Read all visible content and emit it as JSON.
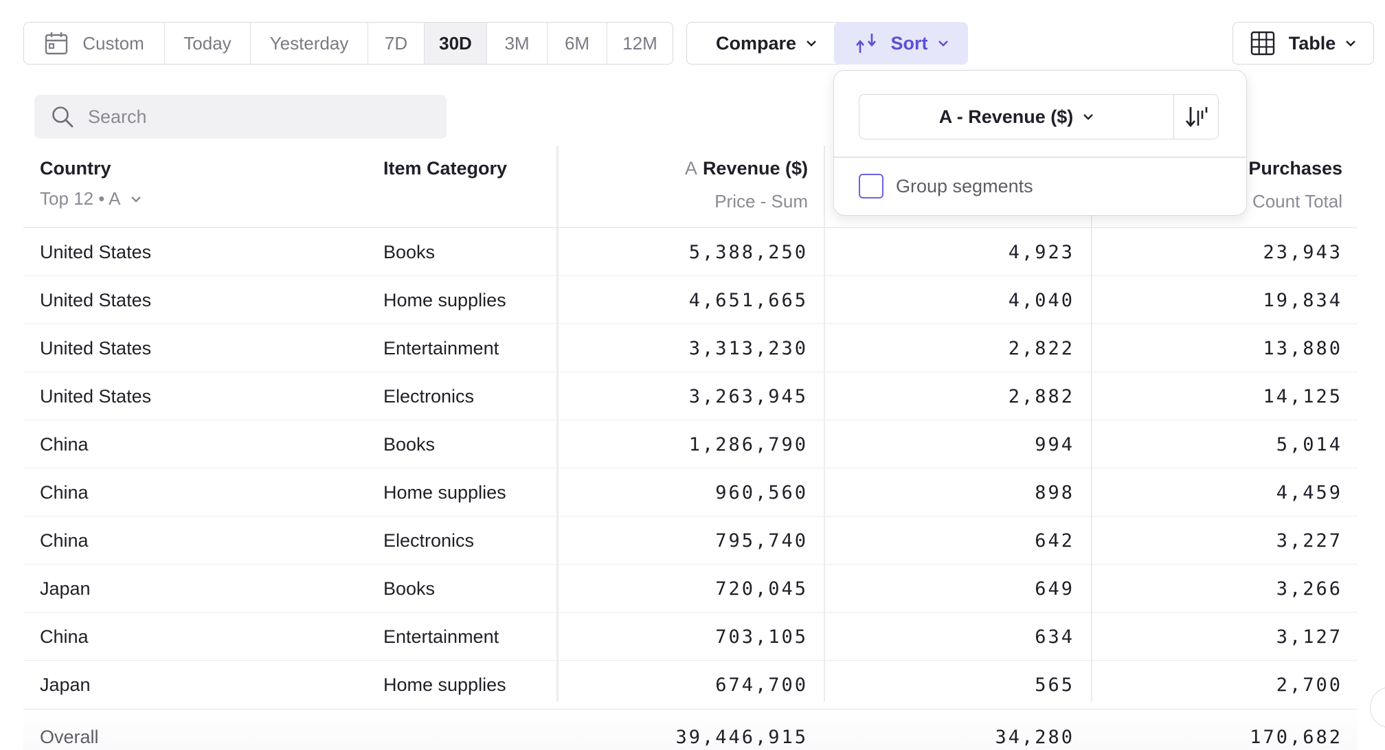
{
  "toolbar": {
    "date_ranges": [
      {
        "label": "Custom",
        "icon": "calendar-icon",
        "active": false
      },
      {
        "label": "Today",
        "active": false
      },
      {
        "label": "Yesterday",
        "active": false
      },
      {
        "label": "7D",
        "active": false
      },
      {
        "label": "30D",
        "active": true
      },
      {
        "label": "3M",
        "active": false
      },
      {
        "label": "6M",
        "active": false
      },
      {
        "label": "12M",
        "active": false
      }
    ],
    "compare_label": "Compare",
    "sort_label": "Sort",
    "view_label": "Table",
    "accent_color": "#5b4fd6"
  },
  "search": {
    "placeholder": "Search"
  },
  "table": {
    "headers": {
      "country": "Country",
      "country_sub": "Top 12 • A",
      "category": "Item Category",
      "a_prefix": "A",
      "a_title": "Revenue ($)",
      "a_sub": "Price - Sum",
      "c_title": "# Purchases",
      "c_sub": "Count Total"
    },
    "rows": [
      {
        "country": "United States",
        "category": "Books",
        "a": "5,388,250",
        "b": "4,923",
        "c": "23,943"
      },
      {
        "country": "United States",
        "category": "Home supplies",
        "a": "4,651,665",
        "b": "4,040",
        "c": "19,834"
      },
      {
        "country": "United States",
        "category": "Entertainment",
        "a": "3,313,230",
        "b": "2,822",
        "c": "13,880"
      },
      {
        "country": "United States",
        "category": "Electronics",
        "a": "3,263,945",
        "b": "2,882",
        "c": "14,125"
      },
      {
        "country": "China",
        "category": "Books",
        "a": "1,286,790",
        "b": "994",
        "c": "5,014"
      },
      {
        "country": "China",
        "category": "Home supplies",
        "a": "960,560",
        "b": "898",
        "c": "4,459"
      },
      {
        "country": "China",
        "category": "Electronics",
        "a": "795,740",
        "b": "642",
        "c": "3,227"
      },
      {
        "country": "Japan",
        "category": "Books",
        "a": "720,045",
        "b": "649",
        "c": "3,266"
      },
      {
        "country": "China",
        "category": "Entertainment",
        "a": "703,105",
        "b": "634",
        "c": "3,127"
      },
      {
        "country": "Japan",
        "category": "Home supplies",
        "a": "674,700",
        "b": "565",
        "c": "2,700"
      }
    ],
    "overall": {
      "label": "Overall",
      "a": "39,446,915",
      "b": "34,280",
      "c": "170,682"
    }
  },
  "sort_popover": {
    "selected_metric": "A - Revenue ($)",
    "order_icon": "sort-descending-icon",
    "group_segments_label": "Group segments",
    "group_segments_checked": false
  }
}
